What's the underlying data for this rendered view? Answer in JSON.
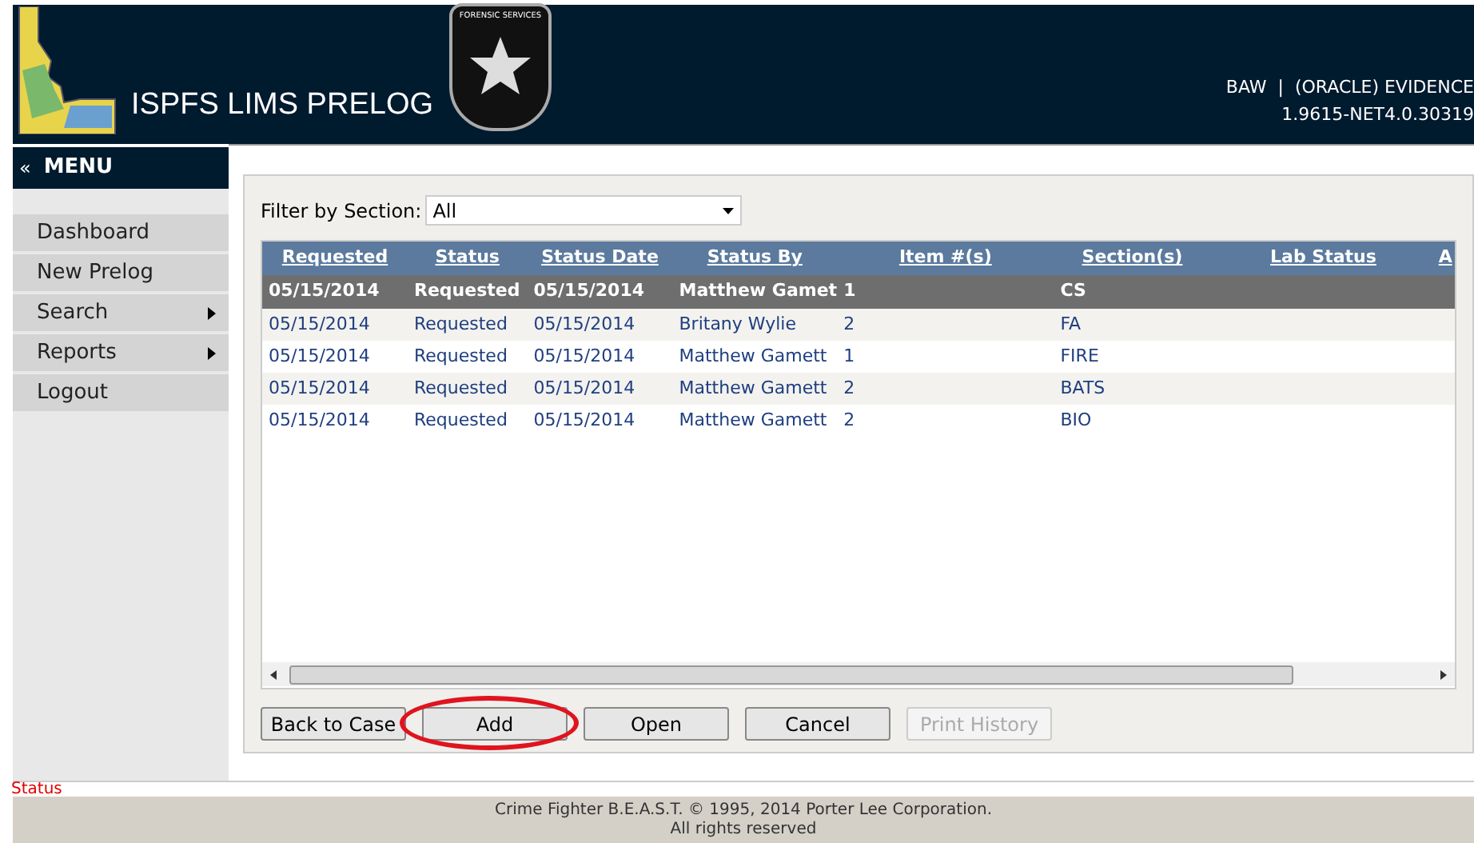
{
  "header": {
    "title": "ISPFS LIMS PRELOG",
    "badge_text": "FORENSIC SERVICES",
    "user_info": "BAW  |  (ORACLE) EVIDENCE",
    "version": "1.9615-NET4.0.30319"
  },
  "menu": {
    "collapse": "«",
    "title": "MENU",
    "items": [
      {
        "label": "Dashboard",
        "submenu": false
      },
      {
        "label": "New Prelog",
        "submenu": false
      },
      {
        "label": "Search",
        "submenu": true
      },
      {
        "label": "Reports",
        "submenu": true
      },
      {
        "label": "Logout",
        "submenu": false
      }
    ]
  },
  "filter": {
    "label": "Filter by Section:",
    "value": "All"
  },
  "table": {
    "columns": [
      "Requested",
      "Status",
      "Status Date",
      "Status By",
      "Item #(s)",
      "Section(s)",
      "Lab Status",
      "A"
    ],
    "rows": [
      {
        "selected": true,
        "cells": [
          "05/15/2014",
          "Requested",
          "05/15/2014",
          "Matthew Gamet",
          "1",
          "CS",
          "",
          ""
        ]
      },
      {
        "selected": false,
        "cells": [
          "05/15/2014",
          "Requested",
          "05/15/2014",
          "Britany Wylie",
          "2",
          "FA",
          "",
          ""
        ]
      },
      {
        "selected": false,
        "cells": [
          "05/15/2014",
          "Requested",
          "05/15/2014",
          "Matthew Gamett",
          "1",
          "FIRE",
          "",
          ""
        ]
      },
      {
        "selected": false,
        "cells": [
          "05/15/2014",
          "Requested",
          "05/15/2014",
          "Matthew Gamett",
          "2",
          "BATS",
          "",
          ""
        ]
      },
      {
        "selected": false,
        "cells": [
          "05/15/2014",
          "Requested",
          "05/15/2014",
          "Matthew Gamett",
          "2",
          "BIO",
          "",
          ""
        ]
      }
    ]
  },
  "buttons": [
    {
      "label": "Back to Case",
      "disabled": false,
      "circled": false
    },
    {
      "label": "Add",
      "disabled": false,
      "circled": true
    },
    {
      "label": "Open",
      "disabled": false,
      "circled": false
    },
    {
      "label": "Cancel",
      "disabled": false,
      "circled": false
    },
    {
      "label": "Print History",
      "disabled": true,
      "circled": false
    }
  ],
  "status": "Status",
  "footer": [
    "Crime Fighter B.E.A.S.T. © 1995, 2014 Porter Lee Corporation.",
    "All rights reserved"
  ]
}
